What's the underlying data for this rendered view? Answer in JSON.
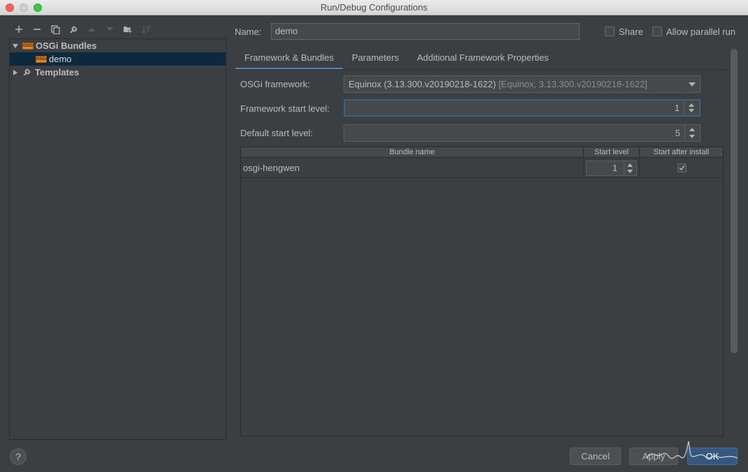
{
  "window": {
    "title": "Run/Debug Configurations"
  },
  "toolbar": {
    "icons": [
      "plus-icon",
      "minus-icon",
      "copy-icon",
      "wrench-icon",
      "arrow-up-icon",
      "arrow-down-icon",
      "new-folder-icon",
      "sort-icon"
    ]
  },
  "tree": {
    "group_label": "OSGi Bundles",
    "item_label": "demo",
    "templates_label": "Templates",
    "badge": "OSGi"
  },
  "header": {
    "name_label": "Name:",
    "name_value": "demo",
    "share_label": "Share",
    "parallel_label": "Allow parallel run"
  },
  "tabs": [
    {
      "label": "Framework & Bundles",
      "active": true
    },
    {
      "label": "Parameters",
      "active": false
    },
    {
      "label": "Additional Framework Properties",
      "active": false
    }
  ],
  "form": {
    "framework_label": "OSGi framework:",
    "framework_value": "Equinox (3.13.300.v20190218-1622)",
    "framework_hint": "[Equinox, 3.13.300.v20190218-1622]",
    "framework_start_label": "Framework start level:",
    "framework_start_value": "1",
    "default_start_label": "Default start level:",
    "default_start_value": "5"
  },
  "table": {
    "columns": [
      "Bundle name",
      "Start level",
      "Start after install"
    ],
    "rows": [
      {
        "bundle": "osgi-hengwen",
        "start_level": "1",
        "start_after_install": true
      }
    ]
  },
  "footer": {
    "help": "?",
    "cancel": "Cancel",
    "apply": "Apply",
    "ok": "OK"
  },
  "colors": {
    "accent": "#4a88c7",
    "primary_button": "#365880",
    "selection": "#0d293e"
  }
}
